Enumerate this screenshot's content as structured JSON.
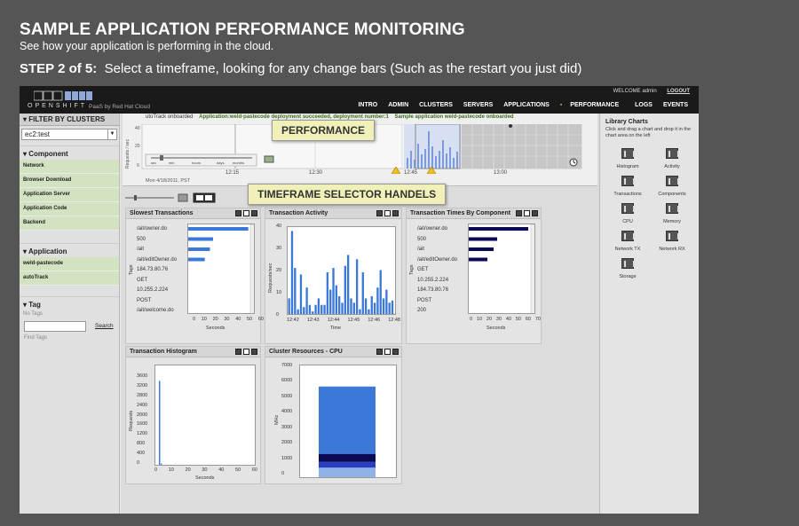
{
  "header": {
    "title": "SAMPLE APPLICATION PERFORMANCE MONITORING",
    "subtitle": "See how your application is performing in the cloud.",
    "step_label": "STEP 2 of 5:",
    "step_text": "Select a timeframe, looking for any change bars (Such as the restart you just did)"
  },
  "app": {
    "logo_text": "OPENSHIFT",
    "logo_sub": "PaaS by Red Hat Cloud",
    "welcome": "WELCOME",
    "user": "admin",
    "logout": "LOGOUT",
    "nav": [
      "INTRO",
      "ADMIN",
      "CLUSTERS",
      "SERVERS",
      "APPLICATIONS",
      "PERFORMANCE",
      "LOGS",
      "EVENTS"
    ],
    "nav_active": "PERFORMANCE",
    "accent": "#8bb84b"
  },
  "sidebar": {
    "filter_title": "FILTER BY CLUSTERS",
    "cluster_selected": "ec2:test",
    "component_title": "Component",
    "components": [
      "Network",
      "Browser Download",
      "Application Server",
      "Application Code",
      "Backend"
    ],
    "application_title": "Application",
    "applications": [
      "weld-pastecode",
      "autoTrack"
    ],
    "tag_title": "Tag",
    "no_tags": "No Tags",
    "search_label": "Search",
    "find_tags": "Find Tags"
  },
  "timeline": {
    "events": [
      "utoTrack onboarded",
      "Application:weld-pastecode deployment succeeded, deployment number:1",
      "Sample application weld-pastecode onboarded"
    ],
    "times": [
      "12:15",
      "12:30",
      "12:45",
      "13:00"
    ],
    "date": "Mon 4/18/2011, PST",
    "zoom_labels": [
      "sec",
      "min",
      "hours",
      "days",
      "months"
    ],
    "ylabel": "Requests / sec",
    "yticks": [
      "40",
      "20",
      "0"
    ]
  },
  "callouts": {
    "performance": "PERFORMANCE",
    "timeframe": "TIMEFRAME SELECTOR HANDELS"
  },
  "panels": {
    "slowest": {
      "title": "Slowest Transactions",
      "tags": [
        "/ait/owner.do",
        "500",
        "/ait",
        "/ait/editOwner.do",
        "184.73.80.76",
        "GET",
        "10.255.2.224",
        "POST",
        "/ait/welcome.do"
      ],
      "xticks": [
        "0",
        "10",
        "20",
        "30",
        "40",
        "50",
        "60"
      ],
      "xlabel": "Seconds",
      "ylabel": "Tags"
    },
    "activity": {
      "title": "Transaction Activity",
      "yticks": [
        "40",
        "30",
        "20",
        "10",
        "0"
      ],
      "xticks": [
        "12:42",
        "12:43",
        "12:44",
        "12:45",
        "12:46",
        "12:48"
      ],
      "xlabel": "Time",
      "ylabel": "Requests/sec"
    },
    "by_component": {
      "title": "Transaction Times By Component",
      "tags": [
        "/ait/owner.do",
        "500",
        "/ait",
        "/ait/editOwner.do",
        "GET",
        "10.255.2.224",
        "184.73.80.76",
        "POST",
        "200"
      ],
      "xticks": [
        "0",
        "10",
        "20",
        "30",
        "40",
        "50",
        "60",
        "70"
      ],
      "xlabel": "Seconds",
      "ylabel": "Tags"
    },
    "histogram": {
      "title": "Transaction Histogram",
      "yticks": [
        "3600",
        "3200",
        "2800",
        "2400",
        "2000",
        "1600",
        "1200",
        "800",
        "400",
        "0"
      ],
      "xticks": [
        "0",
        "10",
        "20",
        "30",
        "40",
        "50",
        "60"
      ],
      "xlabel": "Seconds",
      "ylabel": "Requests"
    },
    "cpu": {
      "title": "Cluster Resources - CPU",
      "yticks": [
        "7000",
        "6000",
        "5000",
        "4000",
        "3000",
        "2000",
        "1000",
        "0"
      ],
      "ylabel": "MHz"
    }
  },
  "library": {
    "title": "Library Charts",
    "desc": "Click and drag a chart and drop it in the chart area on the left",
    "items": [
      "Histogram",
      "Activity",
      "Transactions",
      "Components",
      "CPU",
      "Memory",
      "Network TX",
      "Network RX",
      "Storage"
    ]
  },
  "chart_data": [
    {
      "type": "bar",
      "title": "Slowest Transactions",
      "orientation": "horizontal",
      "categories": [
        "/ait/owner.do",
        "500",
        "/ait",
        "/ait/editOwner.do"
      ],
      "values": [
        58,
        24,
        21,
        16
      ],
      "xlim": [
        0,
        60
      ],
      "xlabel": "Seconds",
      "ylabel": "Tags"
    },
    {
      "type": "bar",
      "title": "Transaction Activity",
      "values": [
        8,
        39,
        22,
        3,
        19,
        4,
        13,
        5,
        2,
        5,
        8,
        5,
        5,
        20,
        12,
        22,
        14,
        9,
        6,
        23,
        28,
        8,
        6,
        26,
        3,
        20,
        8,
        3,
        9,
        6,
        13,
        21,
        8,
        12,
        6,
        7,
        1
      ],
      "ylim": [
        0,
        40
      ],
      "xlabel": "Time",
      "ylabel": "Requests/sec"
    },
    {
      "type": "bar",
      "title": "Transaction Times By Component",
      "orientation": "horizontal",
      "categories": [
        "/ait/owner.do",
        "500",
        "/ait",
        "/ait/editOwner.do"
      ],
      "values": [
        67,
        32,
        28,
        21
      ],
      "xlim": [
        0,
        70
      ],
      "xlabel": "Seconds",
      "ylabel": "Tags"
    },
    {
      "type": "bar",
      "title": "Transaction Histogram",
      "categories": [
        "0",
        "1",
        "2"
      ],
      "values": [
        3550,
        120,
        40
      ],
      "ylim": [
        0,
        3600
      ],
      "xlabel": "Seconds",
      "ylabel": "Requests"
    },
    {
      "type": "bar",
      "title": "Cluster Resources - CPU",
      "stacked": true,
      "series": [
        {
          "values": [
            700
          ],
          "color": "#8fb3e8"
        },
        {
          "values": [
            350
          ],
          "color": "#2a3fbf"
        },
        {
          "values": [
            500
          ],
          "color": "#0a0a55"
        },
        {
          "values": [
            4150
          ],
          "color": "#3b78d8"
        }
      ],
      "ylim": [
        0,
        7000
      ],
      "ylabel": "MHz"
    }
  ]
}
